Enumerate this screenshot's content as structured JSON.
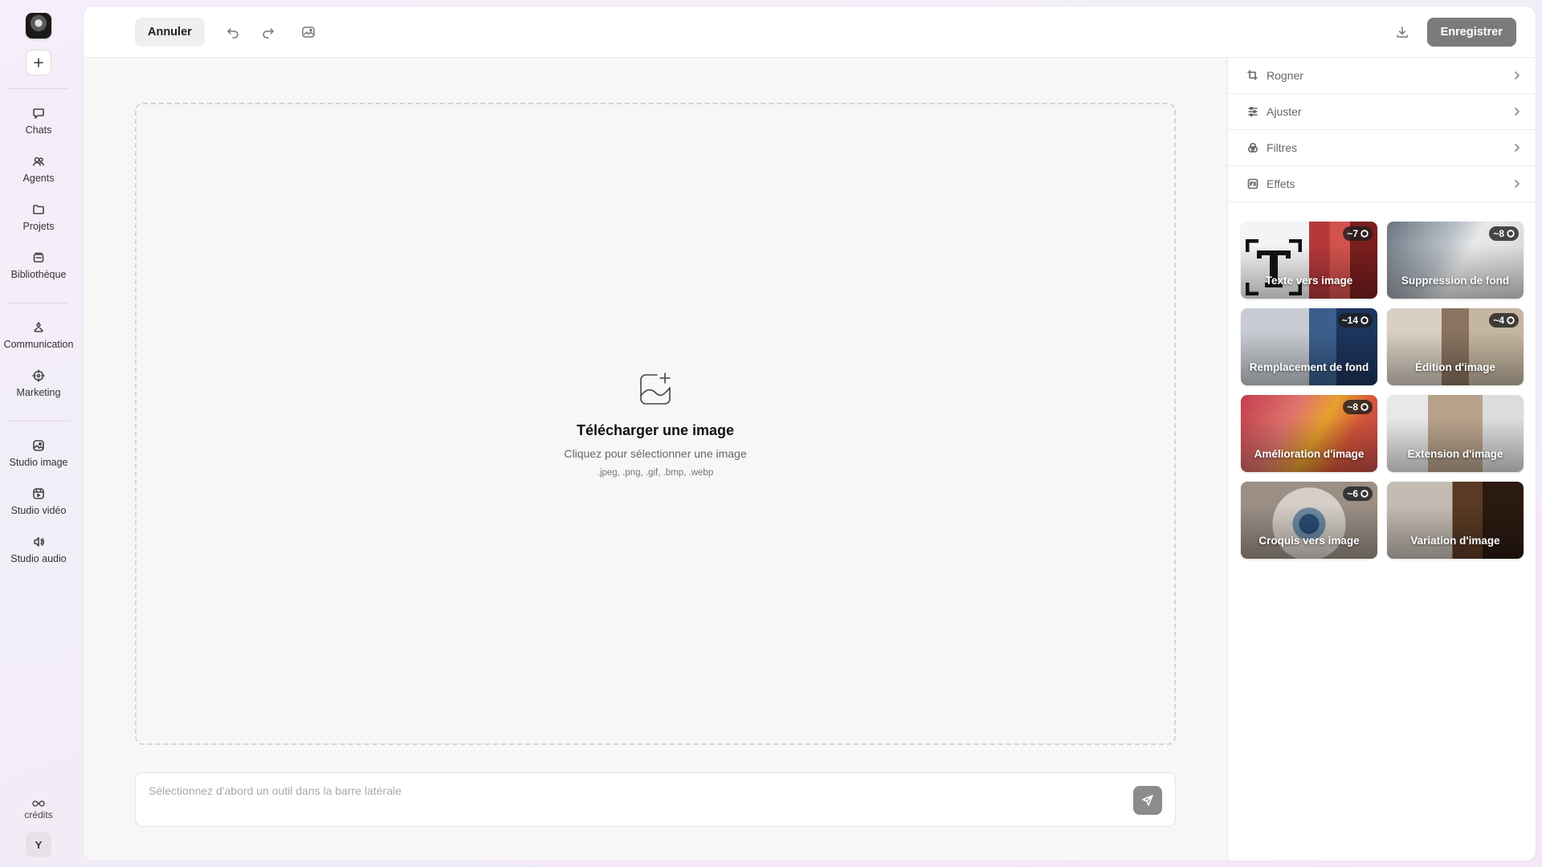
{
  "sidebar": {
    "items": [
      {
        "label": "Chats",
        "icon": "chat-icon"
      },
      {
        "label": "Agents",
        "icon": "agents-icon"
      },
      {
        "label": "Projets",
        "icon": "folder-icon"
      },
      {
        "label": "Bibliothèque",
        "icon": "library-icon"
      },
      {
        "label": "Communication",
        "icon": "communication-icon"
      },
      {
        "label": "Marketing",
        "icon": "marketing-icon"
      },
      {
        "label": "Studio image",
        "icon": "image-studio-icon"
      },
      {
        "label": "Studio vidéo",
        "icon": "video-studio-icon"
      },
      {
        "label": "Studio audio",
        "icon": "audio-studio-icon"
      }
    ],
    "credits_label": "crédits",
    "avatar_letter": "Y"
  },
  "toolbar": {
    "cancel_label": "Annuler",
    "save_label": "Enregistrer"
  },
  "dropzone": {
    "title": "Télécharger une image",
    "subtitle": "Cliquez pour sélectionner une image",
    "formats": ".jpeg, .png, .gif, .bmp, .webp"
  },
  "prompt": {
    "placeholder": "Sélectionnez d'abord un outil dans la barre latérale"
  },
  "panel": {
    "tools": [
      {
        "label": "Rogner",
        "icon": "crop-icon"
      },
      {
        "label": "Ajuster",
        "icon": "adjust-icon"
      },
      {
        "label": "Filtres",
        "icon": "filters-icon"
      },
      {
        "label": "Effets",
        "icon": "effects-icon"
      }
    ],
    "cards": [
      {
        "label": "Texte vers image",
        "cost": "~7"
      },
      {
        "label": "Suppression de fond",
        "cost": "~8"
      },
      {
        "label": "Remplacement de fond",
        "cost": "~14"
      },
      {
        "label": "Édition d'image",
        "cost": "~4"
      },
      {
        "label": "Amélioration d'image",
        "cost": "~8"
      },
      {
        "label": "Extension d'image",
        "cost": ""
      },
      {
        "label": "Croquis vers image",
        "cost": "~6"
      },
      {
        "label": "Variation d'image",
        "cost": ""
      }
    ]
  },
  "colors": {
    "save_button": "#7b7b7b",
    "send_button": "#8c8c8c",
    "canvas_bg": "#f7f7f7"
  }
}
